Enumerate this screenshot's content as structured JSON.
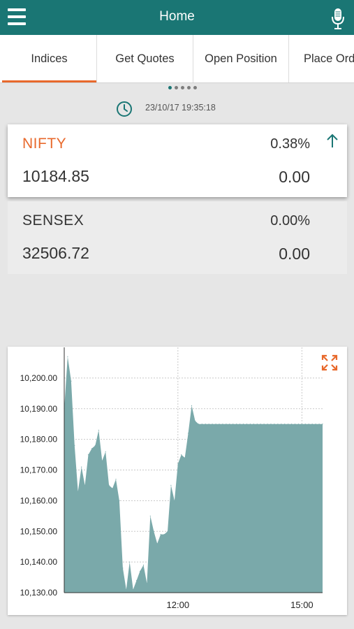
{
  "header": {
    "title": "Home",
    "menu_icon": "hamburger-menu-icon",
    "mic_icon": "microphone-icon"
  },
  "tabs": [
    {
      "label": "Indices",
      "active": true
    },
    {
      "label": "Get Quotes",
      "active": false
    },
    {
      "label": "Open Position",
      "active": false
    },
    {
      "label": "Place Order",
      "active": false
    }
  ],
  "pager": {
    "pages": 5,
    "current": 1
  },
  "timestamp": "23/10/17 19:35:18",
  "colors": {
    "brand": "#1a7674",
    "accent": "#e8692c",
    "chart_fill": "#7aa9aa"
  },
  "indices": [
    {
      "name": "NIFTY",
      "percent": "0.38%",
      "value": "10184.85",
      "change": "0.00",
      "direction": "up"
    },
    {
      "name": "SENSEX",
      "percent": "0.00%",
      "value": "32506.72",
      "change": "0.00"
    }
  ],
  "chart_data": {
    "type": "area",
    "title": "",
    "xlabel": "",
    "ylabel": "",
    "grid": true,
    "xlim": [
      "09:15",
      "15:30"
    ],
    "x_ticks": [
      "12:00",
      "15:00"
    ],
    "ylim": [
      10130,
      10210
    ],
    "y_ticks": [
      "10,130.00",
      "10,140.00",
      "10,150.00",
      "10,160.00",
      "10,170.00",
      "10,180.00",
      "10,190.00",
      "10,200.00"
    ],
    "x": [
      "09:15",
      "09:20",
      "09:25",
      "09:30",
      "09:35",
      "09:40",
      "09:45",
      "09:50",
      "09:55",
      "10:00",
      "10:05",
      "10:10",
      "10:15",
      "10:20",
      "10:25",
      "10:30",
      "10:35",
      "10:40",
      "10:45",
      "10:50",
      "10:55",
      "11:00",
      "11:05",
      "11:10",
      "11:15",
      "11:20",
      "11:25",
      "11:30",
      "11:35",
      "11:40",
      "11:45",
      "11:50",
      "11:55",
      "12:00",
      "12:05",
      "12:10",
      "12:15",
      "12:20",
      "12:25",
      "12:30",
      "12:35",
      "12:40",
      "12:45",
      "12:50",
      "12:55",
      "13:00",
      "13:05",
      "13:10",
      "13:15",
      "13:20",
      "13:25",
      "13:30",
      "13:35",
      "13:40",
      "13:45",
      "13:50",
      "13:55",
      "14:00",
      "14:05",
      "14:10",
      "14:15",
      "14:20",
      "14:25",
      "14:30",
      "14:35",
      "14:40",
      "14:45",
      "14:50",
      "14:55",
      "15:00",
      "15:05",
      "15:10",
      "15:15",
      "15:20",
      "15:25",
      "15:30"
    ],
    "values": [
      10190,
      10207,
      10199,
      10178,
      10163,
      10171,
      10165,
      10175,
      10177,
      10178,
      10183,
      10173,
      10176,
      10165,
      10164,
      10167,
      10160,
      10138,
      10131,
      10140,
      10131,
      10134,
      10137,
      10139,
      10133,
      10155,
      10150,
      10146,
      10149,
      10149,
      10150,
      10165,
      10160,
      10172,
      10175,
      10174,
      10182,
      10191,
      10186,
      10185,
      10185,
      10185,
      10185,
      10185,
      10185,
      10185,
      10185,
      10185,
      10185,
      10185,
      10185,
      10185,
      10185,
      10185,
      10185,
      10185,
      10185,
      10185,
      10185,
      10185,
      10185,
      10185,
      10185,
      10185,
      10185,
      10185,
      10185,
      10185,
      10185,
      10185,
      10185,
      10185,
      10185,
      10185,
      10185,
      10185
    ]
  }
}
